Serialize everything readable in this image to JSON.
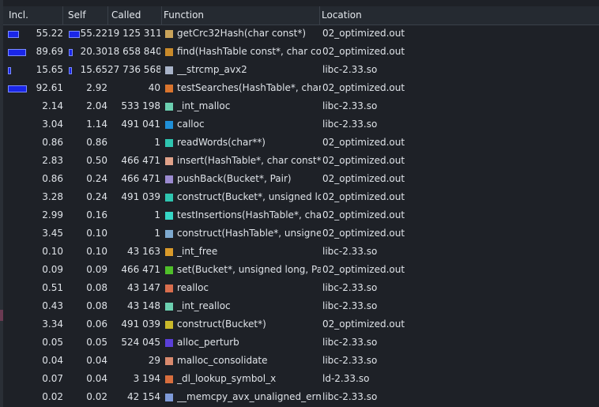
{
  "header": {
    "incl": "Incl.",
    "self": "Self",
    "called": "Called",
    "function": "Function",
    "location": "Location"
  },
  "rows": [
    {
      "incl": "55.22",
      "self": "55.22",
      "called": "19 125 311",
      "function": "getCrc32Hash(char const*)",
      "location": "02_optimized.out",
      "color": "#c9a35a",
      "incl_frac": 0.596,
      "self_frac": 0.596
    },
    {
      "incl": "89.69",
      "self": "20.30",
      "called": "18 658 840",
      "function": "find(HashTable const*, char con...",
      "location": "02_optimized.out",
      "color": "#c98a2a",
      "incl_frac": 0.968,
      "self_frac": 0.219
    },
    {
      "incl": "15.65",
      "self": "15.65",
      "called": "27 736 568",
      "function": "__strcmp_avx2",
      "location": "libc-2.33.so",
      "color": "#a8b3c8",
      "incl_frac": 0.169,
      "self_frac": 0.169
    },
    {
      "incl": "92.61",
      "self": "2.92",
      "called": "40",
      "function": "testSearches(HashTable*, char ...",
      "location": "02_optimized.out",
      "color": "#d9742e",
      "incl_frac": 1.0,
      "self_frac": 0.0
    },
    {
      "incl": "2.14",
      "self": "2.04",
      "called": "533 198",
      "function": "_int_malloc",
      "location": "libc-2.33.so",
      "color": "#6ccfb0",
      "incl_frac": 0,
      "self_frac": 0
    },
    {
      "incl": "3.04",
      "self": "1.14",
      "called": "491 041",
      "function": "calloc",
      "location": "libc-2.33.so",
      "color": "#1f8fd8",
      "incl_frac": 0,
      "self_frac": 0
    },
    {
      "incl": "0.86",
      "self": "0.86",
      "called": "1",
      "function": "readWords(char**)",
      "location": "02_optimized.out",
      "color": "#2fc5b0",
      "incl_frac": 0,
      "self_frac": 0
    },
    {
      "incl": "2.83",
      "self": "0.50",
      "called": "466 471",
      "function": "insert(HashTable*, char const*, ...",
      "location": "02_optimized.out",
      "color": "#e0a28a",
      "incl_frac": 0,
      "self_frac": 0
    },
    {
      "incl": "0.86",
      "self": "0.24",
      "called": "466 471",
      "function": "pushBack(Bucket*, Pair)",
      "location": "02_optimized.out",
      "color": "#9b8ad0",
      "incl_frac": 0,
      "self_frac": 0
    },
    {
      "incl": "3.28",
      "self": "0.24",
      "called": "491 039",
      "function": "construct(Bucket*, unsigned long)",
      "location": "02_optimized.out",
      "color": "#2fc5b0",
      "incl_frac": 0,
      "self_frac": 0
    },
    {
      "incl": "2.99",
      "self": "0.16",
      "called": "1",
      "function": "testInsertions(HashTable*, char...",
      "location": "02_optimized.out",
      "color": "#36d6c6",
      "incl_frac": 0,
      "self_frac": 0
    },
    {
      "incl": "3.45",
      "self": "0.10",
      "called": "1",
      "function": "construct(HashTable*, unsigne...",
      "location": "02_optimized.out",
      "color": "#7eaad0",
      "incl_frac": 0,
      "self_frac": 0
    },
    {
      "incl": "0.10",
      "self": "0.10",
      "called": "43 163",
      "function": "_int_free",
      "location": "libc-2.33.so",
      "color": "#d99a2a",
      "incl_frac": 0,
      "self_frac": 0
    },
    {
      "incl": "0.09",
      "self": "0.09",
      "called": "466 471",
      "function": "set(Bucket*, unsigned long, Pair)",
      "location": "02_optimized.out",
      "color": "#4fbf2a",
      "incl_frac": 0,
      "self_frac": 0
    },
    {
      "incl": "0.51",
      "self": "0.08",
      "called": "43 147",
      "function": "realloc",
      "location": "libc-2.33.so",
      "color": "#d86e4e",
      "incl_frac": 0,
      "self_frac": 0
    },
    {
      "incl": "0.43",
      "self": "0.08",
      "called": "43 148",
      "function": "_int_realloc",
      "location": "libc-2.33.so",
      "color": "#6ccfb0",
      "incl_frac": 0,
      "self_frac": 0
    },
    {
      "incl": "3.34",
      "self": "0.06",
      "called": "491 039",
      "function": "construct(Bucket*)",
      "location": "02_optimized.out",
      "color": "#c9b82a",
      "incl_frac": 0,
      "self_frac": 0
    },
    {
      "incl": "0.05",
      "self": "0.05",
      "called": "524 045",
      "function": "alloc_perturb",
      "location": "libc-2.33.so",
      "color": "#5a3fd8",
      "incl_frac": 0,
      "self_frac": 0
    },
    {
      "incl": "0.04",
      "self": "0.04",
      "called": "29",
      "function": "malloc_consolidate",
      "location": "libc-2.33.so",
      "color": "#d98a6e",
      "incl_frac": 0,
      "self_frac": 0
    },
    {
      "incl": "0.07",
      "self": "0.04",
      "called": "3 194",
      "function": "_dl_lookup_symbol_x",
      "location": "ld-2.33.so",
      "color": "#d86e3e",
      "incl_frac": 0,
      "self_frac": 0
    },
    {
      "incl": "0.02",
      "self": "0.02",
      "called": "42 154",
      "function": "__memcpy_avx_unaligned_erms",
      "location": "libc-2.33.so",
      "color": "#7e9ad8",
      "incl_frac": 0,
      "self_frac": 0
    }
  ]
}
